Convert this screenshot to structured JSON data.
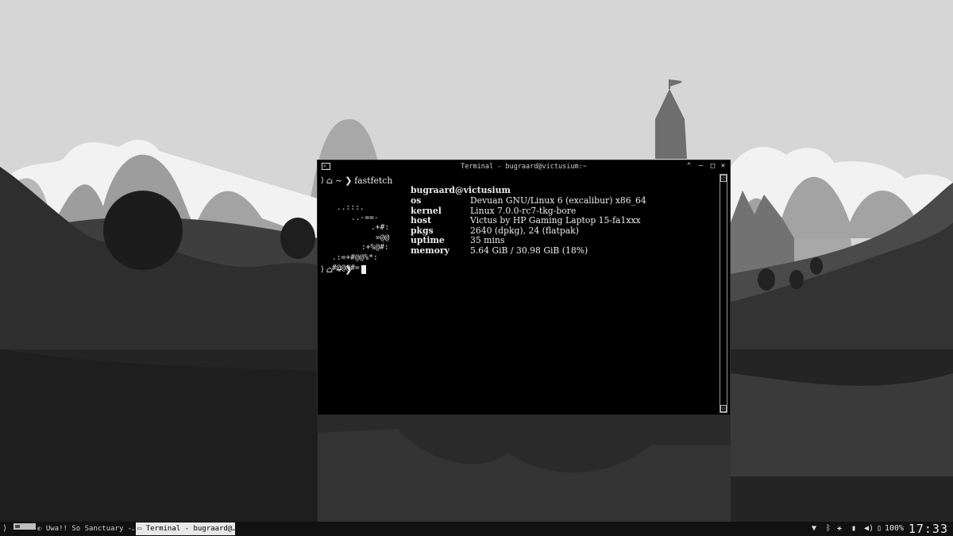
{
  "terminal": {
    "window_title": "Terminal - bugraard@victusium:~",
    "icons": {
      "app": "terminal-icon",
      "collapse": "chevron-up-icon",
      "minimize": "minimize-icon",
      "maximize": "maximize-icon",
      "close": "close-icon"
    },
    "prompt_arrow": "❯",
    "prompt_dir": "~",
    "command": "fastfetch",
    "user_host": "bugraard@victusium",
    "logo_lines": [
      "..:::.",
      "..-==-",
      ".+#:",
      "=@@",
      ":+%@#:",
      ".:=+#@@%*:",
      "#@@@#=:"
    ],
    "info": [
      {
        "key": "os",
        "value": "Devuan GNU/Linux 6 (excalibur) x86_64"
      },
      {
        "key": "kernel",
        "value": "Linux 7.0.0-rc7-tkg-bore"
      },
      {
        "key": "host",
        "value": "Victus by HP Gaming Laptop 15-fa1xxx"
      },
      {
        "key": "pkgs",
        "value": "2640 (dpkg), 24 (flatpak)"
      },
      {
        "key": "uptime",
        "value": "35 mins"
      },
      {
        "key": "memory",
        "value": "5.64 GiB / 30.98 GiB (18%)"
      }
    ]
  },
  "taskbar": {
    "tasks": [
      {
        "label": "Uwa!! So Sanctuary -…",
        "active": false
      },
      {
        "label": "Terminal - bugraard@…",
        "active": true
      }
    ],
    "tray": {
      "battery": "100%",
      "icons": [
        "network-icon",
        "bluetooth-icon",
        "usb-icon",
        "lock-icon",
        "volume-icon",
        "battery-icon"
      ]
    },
    "clock": "17:33"
  }
}
